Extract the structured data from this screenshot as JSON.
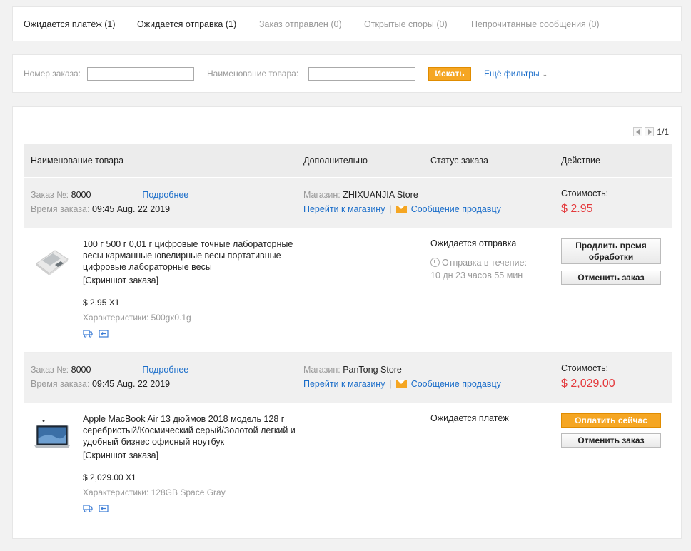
{
  "tabs": [
    {
      "label": "Ожидается платёж",
      "count": "(1)"
    },
    {
      "label": "Ожидается отправка",
      "count": "(1)"
    },
    {
      "label": "Заказ отправлен",
      "count": "(0)"
    },
    {
      "label": "Открытые споры",
      "count": "(0)"
    },
    {
      "label": "Непрочитанные сообщения",
      "count": "(0)"
    }
  ],
  "search": {
    "order_label": "Номер заказа:",
    "order_value": "",
    "product_label": "Наименование товара:",
    "product_value": "",
    "search_button": "Искать",
    "more_filters": "Ещё фильтры"
  },
  "pager": {
    "text": "1/1"
  },
  "table_headers": {
    "product": "Наименование товара",
    "extra": "Дополнительно",
    "status": "Статус заказа",
    "action": "Действие"
  },
  "orders": [
    {
      "order_label": "Заказ №:",
      "order_no": "8000",
      "details_link": "Подробнее",
      "time_label": "Время заказа:",
      "time": "09:45 Aug. 22 2019",
      "store_label": "Магазин:",
      "store": "ZHIXUANJIA Store",
      "goto_store": "Перейти к магазину",
      "sep": "|",
      "message_seller": "Сообщение продавцу",
      "cost_label": "Стоимость:",
      "cost": "$ 2.95",
      "product_title": "100 г 500 г 0,01 г цифровые точные лабораторные весы карманные ювелирные весы портативные цифровые лабораторные весы",
      "snapshot": "[Скриншот заказа]",
      "price_qty": "$ 2.95 X1",
      "attrs": "Характеристики: 500gx0.1g",
      "status": "Ожидается отправка",
      "ship_label": "Отправка в течение:",
      "ship_time": "10 дн 23 часов 55 мин",
      "btn1": "Продлить время обработки",
      "btn2": "Отменить заказ",
      "thumb_icon": "digital-scale-thumbnail"
    },
    {
      "order_label": "Заказ №:",
      "order_no": "8000",
      "details_link": "Подробнее",
      "time_label": "Время заказа:",
      "time": "09:45 Aug. 22 2019",
      "store_label": "Магазин:",
      "store": "PanTong Store",
      "goto_store": "Перейти к магазину",
      "sep": "|",
      "message_seller": "Сообщение продавцу",
      "cost_label": "Стоимость:",
      "cost": "$ 2,029.00",
      "product_title": "Apple MacBook Air 13 дюймов 2018 модель 128 г серебристый/Космический серый/Золотой легкий и удобный бизнес офисный ноутбук",
      "snapshot": "[Скриншот заказа]",
      "price_qty": "$ 2,029.00 X1",
      "attrs": "Характеристики: 128GB Space Gray",
      "status": "Ожидается платёж",
      "btn1": "Оплатить сейчас",
      "btn2": "Отменить заказ",
      "thumb_icon": "laptop-thumbnail"
    }
  ],
  "colors": {
    "accent": "#f5a623",
    "link": "#1a6dc9",
    "price": "#e4393c"
  },
  "icons": [
    "chevron-down-icon",
    "mail-icon",
    "clock-icon",
    "truck-icon",
    "return-icon",
    "prev-page-icon",
    "next-page-icon"
  ]
}
